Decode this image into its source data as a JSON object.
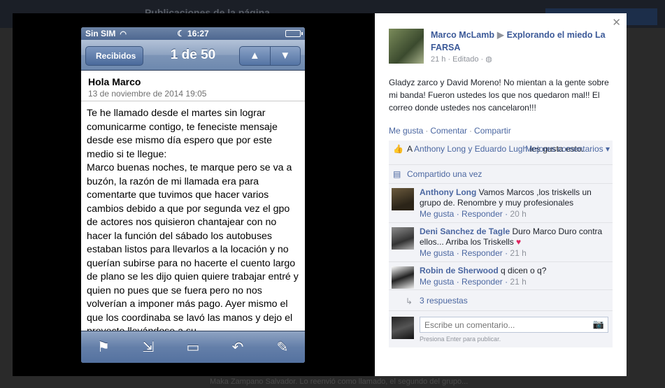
{
  "background": {
    "header": "Publicaciones de la página",
    "footer": "Maka Zampano Salvador. Lo reenvió como llamado, el segundo del grupo..."
  },
  "phone": {
    "status": {
      "carrier": "Sin SIM",
      "time": "16:27"
    },
    "nav": {
      "back_label": "Recibidos",
      "counter": "1 de 50",
      "up_label": "▲",
      "down_label": "▼"
    },
    "mail": {
      "subject": "Hola Marco",
      "date": "13 de noviembre de 2014 19:05",
      "body": "Te he llamado desde el martes sin lograr comunicarme contigo, te feneciste mensaje desde ese mismo día espero que por este medio si te llegue:\nMarco buenas noches, te marque pero se va a buzón, la razón de mi llamada era para comentarte que tuvimos que hacer varios cambios debido a que por segunda vez el gpo de actores nos quisieron chantajear con no hacer la función del sábado los autobuses estaban listos para llevarlos a la locación y no querían subirse para no hacerte el cuento largo de plano se les dijo quien quiere trabajar entré y quien no pues que se fuera pero no nos volverían a imponer más pago. Ayer mismo el que los coordinaba se lavó las manos y dejo el proyecto llevándose a su"
    },
    "toolbar": [
      "flag-icon",
      "move-folder-icon",
      "archive-icon",
      "reply-icon",
      "compose-icon"
    ]
  },
  "post": {
    "author": "Marco McLamb",
    "target": "Explorando el miedo La FARSA",
    "meta": "21 h · Editado ·",
    "text": "Gladyz zarco y David Moreno! No mientan a la gente sobre mi banda! Fueron ustedes los que nos quedaron mal!! El correo donde ustedes nos cancelaron!!!",
    "actions": {
      "like": "Me gusta",
      "comment": "Comentar",
      "share": "Compartir"
    },
    "likes": {
      "prefix": "A ",
      "names": "Anthony Long y Eduardo Lugh",
      "suffix": " les gusta esto."
    },
    "best_comments": "Mejores comentarios ▾",
    "shared": "Compartido una vez",
    "comments": [
      {
        "author": "Anthony Long",
        "text": " Vamos Marcos ,los triskells un grupo de. Renombre y muy profesionales",
        "like": "Me gusta",
        "reply": "Responder",
        "time": "20 h"
      },
      {
        "author": "Deni Sanchez de Tagle",
        "text": " Duro Marco Duro contra ellos... Arriba los Triskells ",
        "like": "Me gusta",
        "reply": "Responder",
        "time": "21 h"
      },
      {
        "author": "Robin de Sherwood",
        "text": " q dicen o q?",
        "like": "Me gusta",
        "reply": "Responder",
        "time": "21 h"
      }
    ],
    "replies": "3 respuestas",
    "comment_placeholder": "Escribe un comentario...",
    "enter_hint": "Presiona Enter para publicar."
  }
}
